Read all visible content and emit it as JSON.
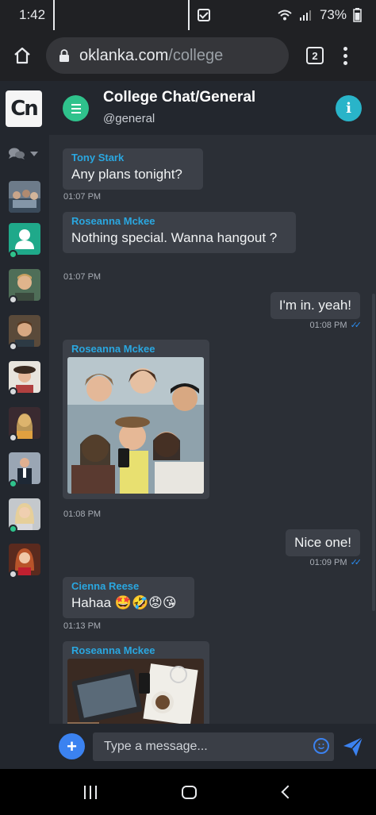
{
  "status_bar": {
    "time": "1:42",
    "battery": "73%"
  },
  "browser": {
    "url_domain": "oklanka.com",
    "url_path": "/college",
    "tab_count": "2"
  },
  "sidebar": {
    "logo": "Cn",
    "avatars": [
      {
        "name": "group-photo-avatar",
        "presence": "none"
      },
      {
        "name": "default-user-avatar",
        "presence": "online"
      },
      {
        "name": "user-avatar-1",
        "presence": "offline"
      },
      {
        "name": "user-avatar-2",
        "presence": "offline"
      },
      {
        "name": "user-avatar-3",
        "presence": "offline"
      },
      {
        "name": "user-avatar-4",
        "presence": "offline"
      },
      {
        "name": "user-avatar-5",
        "presence": "online"
      },
      {
        "name": "user-avatar-6",
        "presence": "online"
      },
      {
        "name": "user-avatar-7",
        "presence": "offline"
      }
    ]
  },
  "header": {
    "title": "College Chat/General",
    "handle": "@general",
    "info_label": "i"
  },
  "messages": [
    {
      "direction": "in",
      "sender": "Tony Stark",
      "text": "Any plans tonight?",
      "time": "01:07 PM"
    },
    {
      "direction": "in",
      "sender": "Roseanna Mckee",
      "text": "Nothing special. Wanna hangout ?",
      "time": "01:07 PM"
    },
    {
      "direction": "out",
      "text": "I'm in. yeah!",
      "time": "01:08 PM"
    },
    {
      "direction": "in",
      "sender": "Roseanna Mckee",
      "image": "group-selfie-photo",
      "time": "01:08 PM"
    },
    {
      "direction": "out",
      "text": "Nice one!",
      "time": "01:09 PM"
    },
    {
      "direction": "in",
      "sender": "Cienna Reese",
      "text": "Hahaa 🤩🤣😡😘",
      "time": "01:13 PM"
    },
    {
      "direction": "in",
      "sender": "Roseanna Mckee",
      "image": "laptop-desk-photo"
    }
  ],
  "composer": {
    "placeholder": "Type a message..."
  },
  "colors": {
    "accent_green": "#2fc28c",
    "accent_cyan": "#29b4c9",
    "accent_blue": "#3b82f0",
    "sender_blue": "#2aa7e0",
    "online": "#2fc28c",
    "offline": "#d7d9dc"
  }
}
